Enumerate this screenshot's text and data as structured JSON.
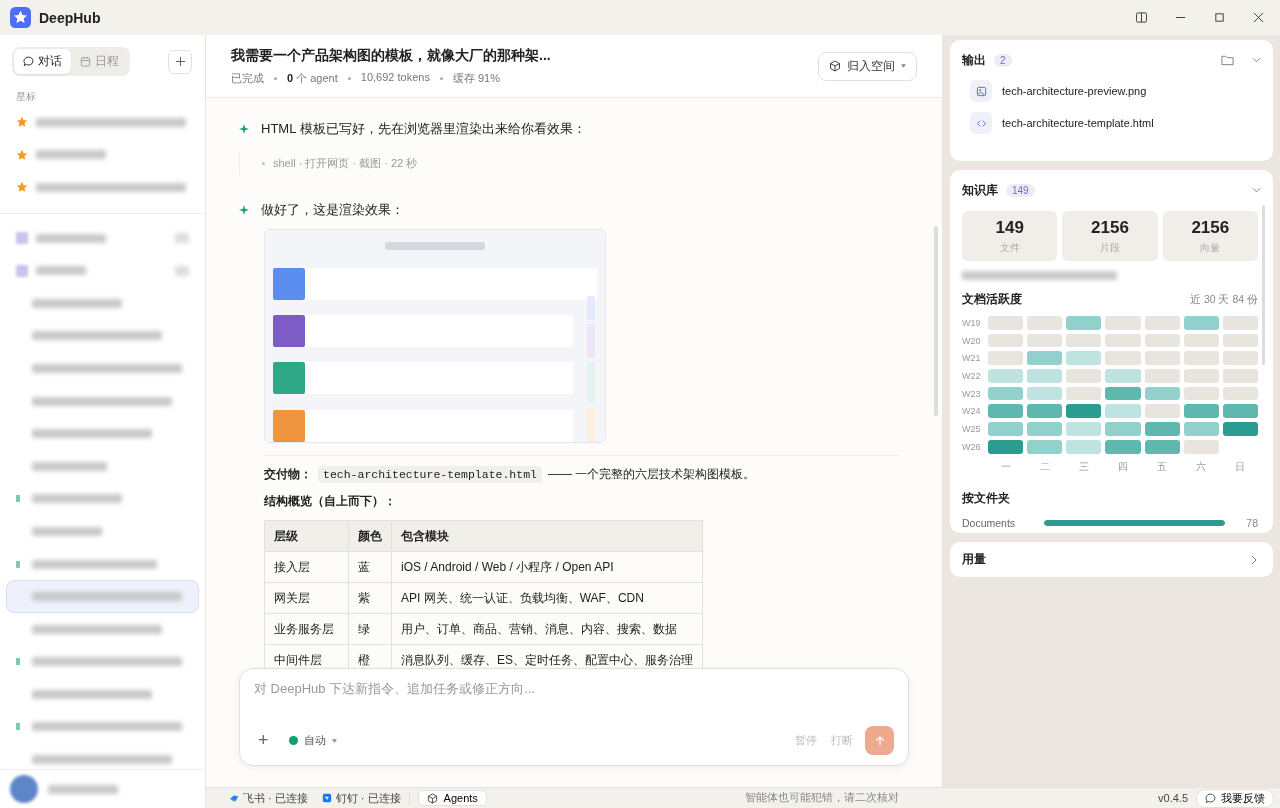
{
  "app": {
    "name": "DeepHub"
  },
  "sidebar": {
    "tabs": [
      {
        "label": "对话",
        "selected": true
      },
      {
        "label": "日程",
        "selected": false
      }
    ],
    "section_label": "星标",
    "items": [
      {
        "kind": "starred",
        "selected": false
      },
      {
        "kind": "starred",
        "selected": false
      },
      {
        "kind": "starred",
        "selected": false
      },
      {
        "kind": "icon",
        "selected": false
      },
      {
        "kind": "icon",
        "selected": false
      },
      {
        "kind": "plain",
        "selected": false
      },
      {
        "kind": "plain",
        "selected": false
      },
      {
        "kind": "plain",
        "selected": false
      },
      {
        "kind": "plain",
        "selected": false
      },
      {
        "kind": "plain",
        "selected": false
      },
      {
        "kind": "plain",
        "selected": false
      },
      {
        "kind": "marked",
        "selected": false
      },
      {
        "kind": "plain",
        "selected": false
      },
      {
        "kind": "marked",
        "selected": false
      },
      {
        "kind": "plain",
        "selected": true
      },
      {
        "kind": "plain",
        "selected": false
      },
      {
        "kind": "marked",
        "selected": false
      },
      {
        "kind": "plain",
        "selected": false
      },
      {
        "kind": "marked",
        "selected": false
      },
      {
        "kind": "plain",
        "selected": false
      }
    ]
  },
  "conversation": {
    "title": "我需要一个产品架构图的模板，就像大厂的那种架...",
    "status": "已完成",
    "agents_count": "0",
    "agents_label": "个 agent",
    "tokens": "10,692 tokens",
    "cache": "缓存 91%",
    "space_button": "归入空间"
  },
  "messages": [
    {
      "kind": "text",
      "text": "HTML 模板已写好，先在浏览器里渲染出来给你看效果："
    },
    {
      "kind": "tool",
      "text": "shell · 打开网页 · 截图 · 22 秒"
    },
    {
      "kind": "text",
      "text": "做好了，这是渲染效果："
    },
    {
      "kind": "picture"
    },
    {
      "kind": "deliverable",
      "label": "交付物：",
      "code": "tech-architecture-template.html",
      "text": "—— 一个完整的六层技术架构图模板。"
    },
    {
      "kind": "heading",
      "text": "结构概览（自上而下）："
    },
    {
      "kind": "table",
      "columns": [
        "层级",
        "颜色",
        "包含模块"
      ],
      "rows": [
        [
          "接入层",
          "蓝",
          "iOS / Android / Web / 小程序 / Open API"
        ],
        [
          "网关层",
          "紫",
          "API 网关、统一认证、负载均衡、WAF、CDN"
        ],
        [
          "业务服务层",
          "绿",
          "用户、订单、商品、营销、消息、内容、搜索、数据"
        ],
        [
          "中间件层",
          "橙",
          "消息队列、缓存、ES、定时任务、配置中心、服务治理"
        ]
      ]
    }
  ],
  "composer": {
    "placeholder": "对 DeepHub 下达新指令、追加任务或修正方向...",
    "add": "+",
    "mode": "自动",
    "pause": "暂停",
    "interrupt": "打断"
  },
  "status_bar": {
    "connections": [
      {
        "label": "飞书 · 已连接"
      },
      {
        "label": "钉钉 · 已连接"
      }
    ],
    "agents_button": "Agents",
    "notice": "智能体也可能犯错，请二次核对",
    "version": "v0.4.5",
    "feedback": "我要反馈"
  },
  "output": {
    "title": "输出",
    "count": "2",
    "files": [
      {
        "name": "tech-architecture-preview.png"
      },
      {
        "name": "tech-architecture-template.html"
      }
    ]
  },
  "knowledge": {
    "title": "知识库",
    "count": "149",
    "stats": [
      {
        "value": "149",
        "label": "文件"
      },
      {
        "value": "2156",
        "label": "片段"
      },
      {
        "value": "2156",
        "label": "向量"
      }
    ],
    "activity_title": "文档活跃度",
    "activity_note": "近 30 天 84 份",
    "weeks": [
      {
        "label": "W19",
        "days": [
          {
            "color": "#e8e4de"
          },
          {
            "color": "#e8e4de"
          },
          {
            "color": "#92d1cb"
          },
          {
            "color": "#e8e4de"
          },
          {
            "color": "#e8e4de"
          },
          {
            "color": "#92d1cb"
          },
          {
            "color": "#e8e4de"
          }
        ]
      },
      {
        "label": "W20",
        "days": [
          {
            "color": "#e8e4de"
          },
          {
            "color": "#e8e4de"
          },
          {
            "color": "#e8e4de"
          },
          {
            "color": "#e8e4de"
          },
          {
            "color": "#e8e4de"
          },
          {
            "color": "#e8e4de"
          },
          {
            "color": "#e8e4de"
          }
        ]
      },
      {
        "label": "W21",
        "days": [
          {
            "color": "#e8e4de"
          },
          {
            "color": "#92d1cb"
          },
          {
            "color": "#bfe3e0"
          },
          {
            "color": "#e8e4de"
          },
          {
            "color": "#e8e4de"
          },
          {
            "color": "#e8e4de"
          },
          {
            "color": "#e8e4de"
          }
        ]
      },
      {
        "label": "W22",
        "days": [
          {
            "color": "#bfe3e0"
          },
          {
            "color": "#bfe3e0"
          },
          {
            "color": "#e8e4de"
          },
          {
            "color": "#bfe3e0"
          },
          {
            "color": "#e8e4de"
          },
          {
            "color": "#e8e4de"
          },
          {
            "color": "#e8e4de"
          }
        ]
      },
      {
        "label": "W23",
        "days": [
          {
            "color": "#92d1cb"
          },
          {
            "color": "#bfe3e0"
          },
          {
            "color": "#e8e4de"
          },
          {
            "color": "#5fb8ae"
          },
          {
            "color": "#92d1cb"
          },
          {
            "color": "#e8e4de"
          },
          {
            "color": "#e8e4de"
          }
        ]
      },
      {
        "label": "W24",
        "days": [
          {
            "color": "#5fb8ae"
          },
          {
            "color": "#5fb8ae"
          },
          {
            "color": "#2a9d90"
          },
          {
            "color": "#bfe3e0"
          },
          {
            "color": "#e8e4de"
          },
          {
            "color": "#5fb8ae"
          },
          {
            "color": "#5fb8ae"
          }
        ]
      },
      {
        "label": "W25",
        "days": [
          {
            "color": "#92d1cb"
          },
          {
            "color": "#92d1cb"
          },
          {
            "color": "#bfe3e0"
          },
          {
            "color": "#92d1cb"
          },
          {
            "color": "#5fb8ae"
          },
          {
            "color": "#92d1cb"
          },
          {
            "color": "#2a9d90"
          }
        ]
      },
      {
        "label": "W26",
        "days": [
          {
            "color": "#2a9d90"
          },
          {
            "color": "#92d1cb"
          },
          {
            "color": "#bfe3e0"
          },
          {
            "color": "#5fb8ae"
          },
          {
            "color": "#5fb8ae"
          },
          {
            "color": "#e8e4de"
          }
        ]
      }
    ],
    "weekdays": [
      "一",
      "二",
      "三",
      "四",
      "五",
      "六",
      "日"
    ],
    "folders_title": "按文件夹",
    "folders": [
      {
        "name": "Documents",
        "level": 1,
        "count": "78"
      }
    ]
  },
  "usage": {
    "title": "用量"
  }
}
